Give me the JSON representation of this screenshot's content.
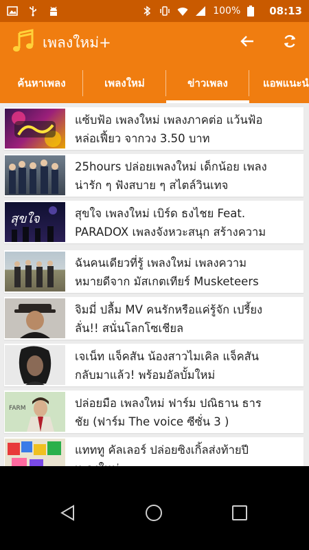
{
  "status_bar": {
    "battery_text": "100%",
    "time": "08:13",
    "icons": [
      "image-icon",
      "usb-icon",
      "android-icon",
      "bluetooth-icon",
      "vibrate-icon",
      "wifi-icon",
      "signal-icon",
      "battery-icon"
    ]
  },
  "app_bar": {
    "title": "เพลงใหม่+",
    "icons": [
      "music-note-icon",
      "back-arrow-icon",
      "refresh-icon"
    ],
    "color": "#f07d10",
    "status_color": "#c95a00"
  },
  "tabs": [
    {
      "label": "ค้นหาเพลง",
      "active": false
    },
    {
      "label": "เพลงใหม่",
      "active": false
    },
    {
      "label": "ข่าวเพลง",
      "active": true
    },
    {
      "label": "แอพแนะนำ",
      "active": false
    }
  ],
  "news": [
    {
      "text": "แซ้บฟ้อ เพลงใหม่ เพลงภาคต่อ แว้นฟ้อ\nหล่อเฟี้ยว จากวง 3.50 บาท",
      "thumb": "band-logo"
    },
    {
      "text": "25hours ปล่อยเพลงใหม่ เด็กน้อย เพลง\nน่ารัก ๆ ฟังสบาย ๆ สไตล์วินเทจ",
      "thumb": "band-photo"
    },
    {
      "text": "สุขใจ เพลงใหม่ เบิร์ด ธงไชย Feat.\nPARADOX เพลงจังหวะสนุก สร้างความ\nสุขใจ",
      "thumb": "concert"
    },
    {
      "text": "ฉันคนเดียวที่รู้ เพลงใหม่ เพลงความ\nหมายดีจาก มัสเกตเทียร์ Musketeers",
      "thumb": "field-band"
    },
    {
      "text": "จิมมี่ ปลื้ม MV คนรักหรือแค่รู้จัก เปรี้ยง\nลั่น!! สนั่นโลกโซเชียล",
      "thumb": "man-hat"
    },
    {
      "text": "เจเน็ท แจ็คสัน น้องสาวไมเคิล แจ็คสัน\nกลับมาแล้ว! พร้อมอัลบั้มใหม่",
      "thumb": "woman-portrait"
    },
    {
      "text": "ปล่อยมือ เพลงใหม่ ฟาร์ม ปณิธาน ธาร\nชัย (ฟาร์ม The voice ซีซั่น 3 )",
      "thumb": "farm-cover"
    },
    {
      "text": "แทททู คัลเลอร์ ปล่อยซิงเกิ้ลส่งท้ายปี\nเพลงใหม่",
      "thumb": "colorful-cover"
    }
  ],
  "nav_bar": {
    "icons": [
      "back-triangle-icon",
      "home-circle-icon",
      "recents-square-icon"
    ]
  }
}
